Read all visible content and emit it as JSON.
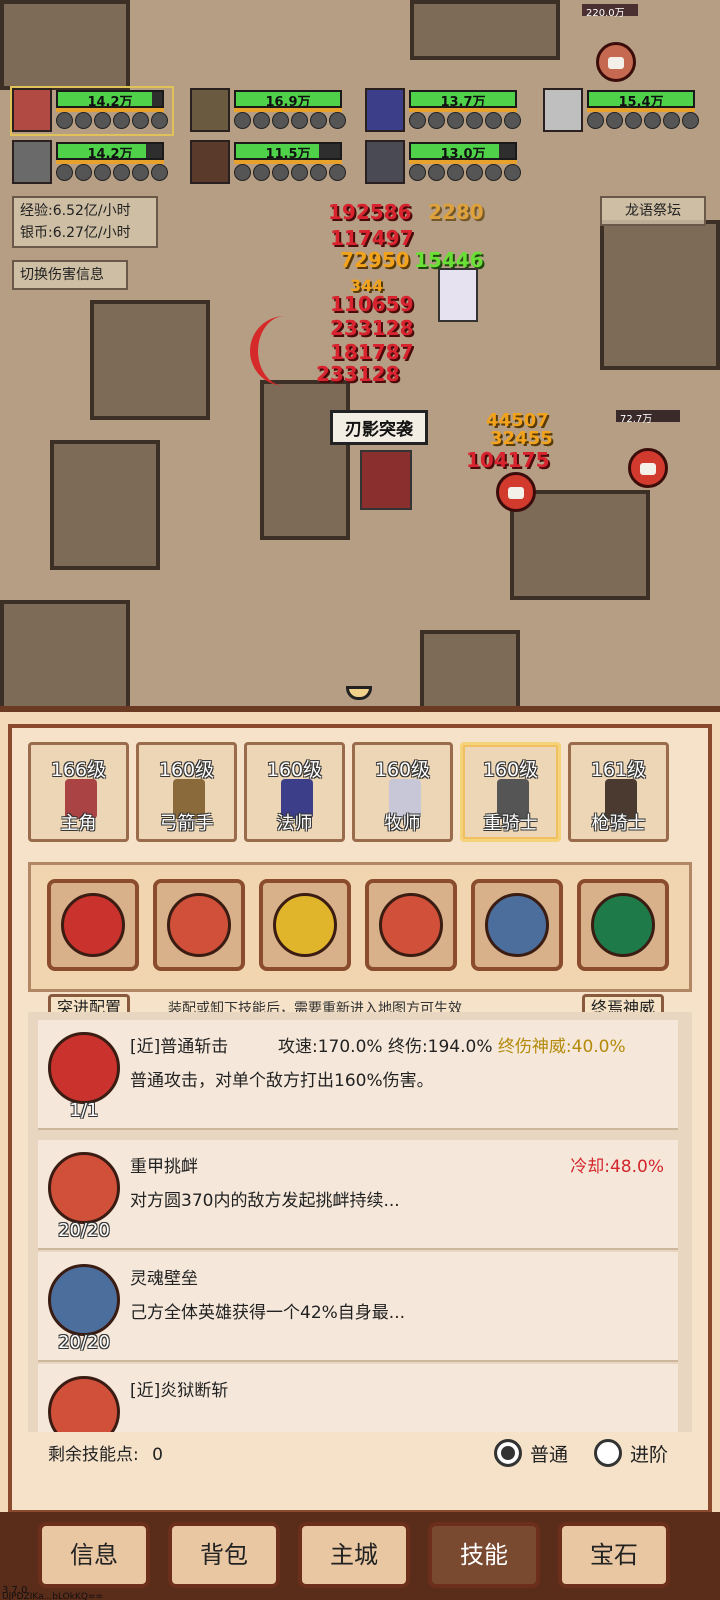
{
  "top_status": {
    "boss_hp": "220.0万"
  },
  "party": [
    {
      "hp": "14.2万",
      "hp_frac": 0.9,
      "selected": true
    },
    {
      "hp": "16.9万",
      "hp_frac": 1.0,
      "selected": false
    },
    {
      "hp": "13.7万",
      "hp_frac": 1.0,
      "selected": false
    },
    {
      "hp": "15.4万",
      "hp_frac": 1.0,
      "selected": false
    },
    {
      "hp": "14.2万",
      "hp_frac": 0.85,
      "selected": false
    },
    {
      "hp": "11.5万",
      "hp_frac": 0.8,
      "selected": false
    },
    {
      "hp": "13.0万",
      "hp_frac": 0.85,
      "selected": false
    }
  ],
  "stats": {
    "exp": "经验:6.52亿/小时",
    "silver": "银币:6.27亿/小时"
  },
  "toggle_damage": "切换伤害信息",
  "location": "龙语祭坛",
  "damage_numbers": [
    "192586",
    "2280",
    "117497",
    "72950",
    "15446",
    "344",
    "110659",
    "233128",
    "181787",
    "233128",
    "44507",
    "32455",
    "104175"
  ],
  "skill_popup": "刃影突袭",
  "enemy_hp": "72.7万",
  "heroes": [
    {
      "level": "166级",
      "name": "主角"
    },
    {
      "level": "160级",
      "name": "弓箭手"
    },
    {
      "level": "160级",
      "name": "法师"
    },
    {
      "level": "160级",
      "name": "牧师"
    },
    {
      "level": "160级",
      "name": "重骑士"
    },
    {
      "level": "161级",
      "name": "枪骑士"
    }
  ],
  "active_hero": 4,
  "slot_buttons": {
    "left": "突进配置",
    "right": "终焉神威"
  },
  "slot_hint": "装配或卸下技能后，需要重新进入地图方可生效",
  "skills": [
    {
      "title": "[近]普通斩击",
      "stats": "攻速:170.0%  终伤:194.0%",
      "highlight": "终伤神威:40.0%",
      "desc": "普通攻击，对单个敌方打出160%伤害。",
      "count": "1/1",
      "color": "#c9322d"
    },
    {
      "title": "重甲挑衅",
      "cooldown": "冷却:48.0%",
      "desc": "对方圆370内的敌方发起挑衅持续...",
      "count": "20/20",
      "color": "#d0503a"
    },
    {
      "title": "灵魂壁垒",
      "desc": "己方全体英雄获得一个42%自身最...",
      "count": "20/20",
      "color": "#4b6e9c"
    },
    {
      "title": "[近]炎狱断斩",
      "desc": "",
      "count": "",
      "color": "#d0503a"
    }
  ],
  "remaining_points_label": "剩余技能点:",
  "remaining_points": "0",
  "mode": {
    "normal": "普通",
    "advanced": "进阶",
    "selected": "normal"
  },
  "nav": [
    {
      "label": "信息"
    },
    {
      "label": "背包"
    },
    {
      "label": "主城"
    },
    {
      "label": "技能",
      "active": true
    },
    {
      "label": "宝石"
    }
  ],
  "version": "3.7.0",
  "device_code": "UJPDZIKa...bLOkKQ=="
}
